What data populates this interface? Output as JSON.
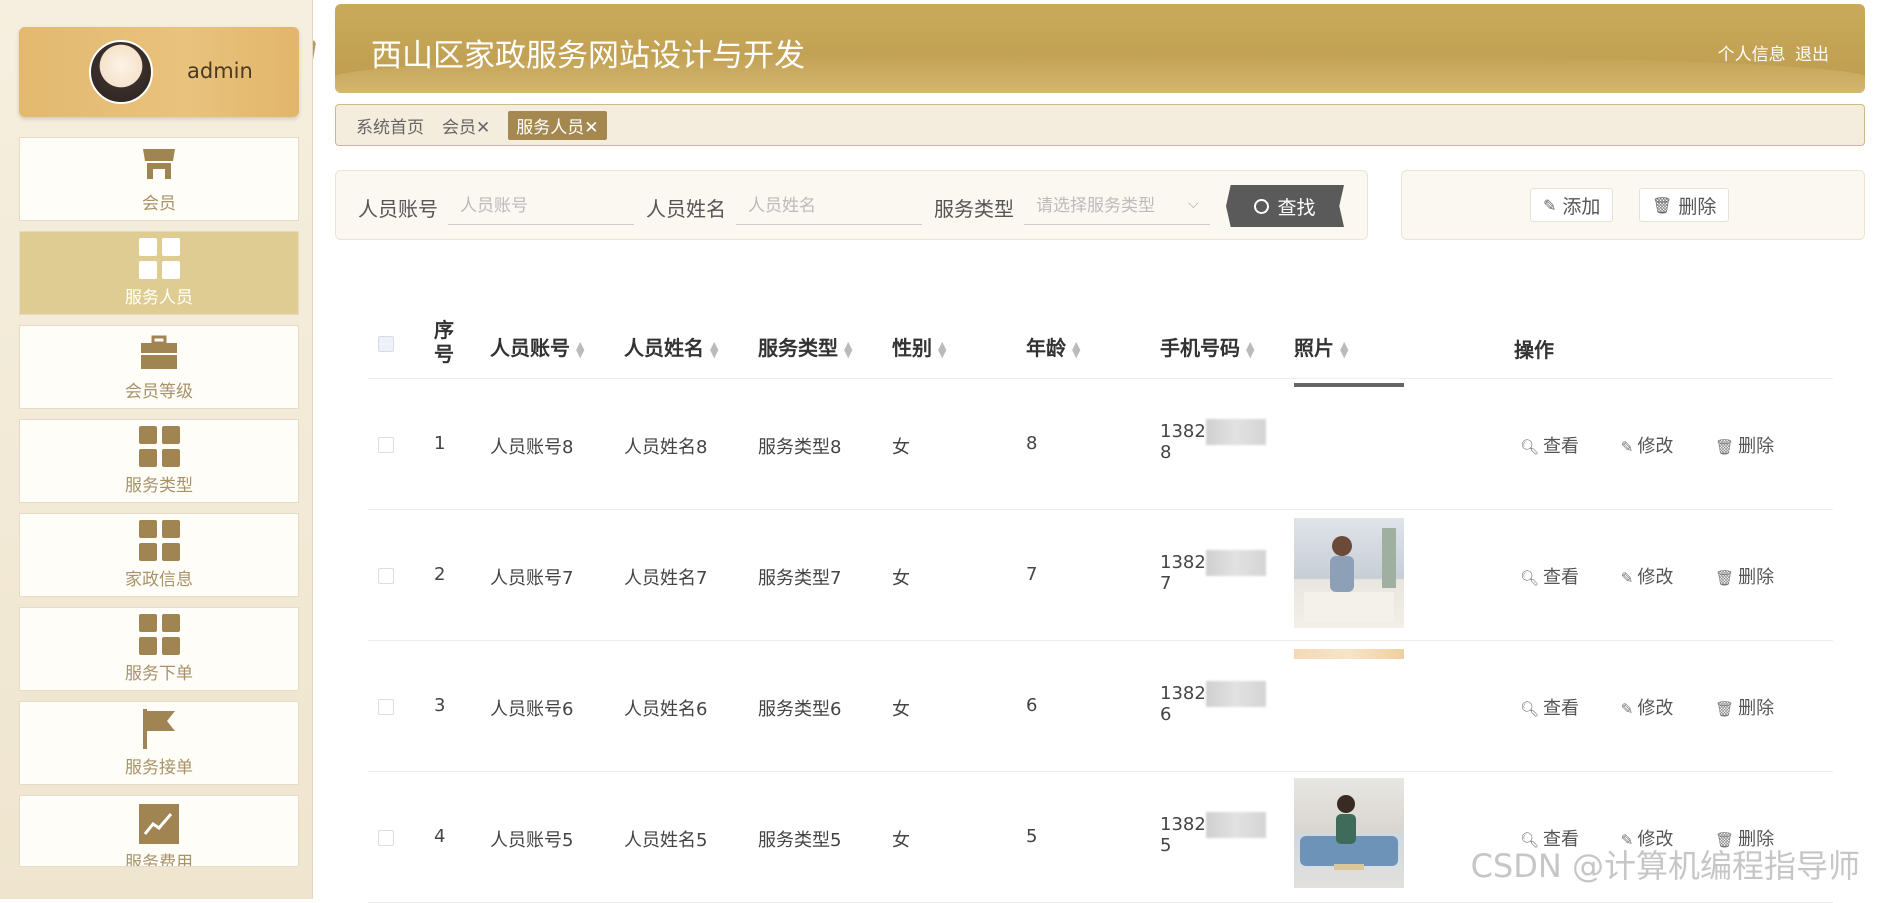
{
  "header": {
    "title": "西山区家政服务网站设计与开发",
    "profile_link": "个人信息",
    "logout_link": "退出"
  },
  "user": {
    "name": "admin"
  },
  "sidebar": {
    "items": [
      {
        "label": "会员",
        "icon": "shop-icon"
      },
      {
        "label": "服务人员",
        "icon": "grid-icon",
        "active": true
      },
      {
        "label": "会员等级",
        "icon": "briefcase-icon"
      },
      {
        "label": "服务类型",
        "icon": "grid-icon"
      },
      {
        "label": "家政信息",
        "icon": "grid-icon"
      },
      {
        "label": "服务下单",
        "icon": "grid-icon"
      },
      {
        "label": "服务接单",
        "icon": "flag-icon"
      },
      {
        "label": "服务费用",
        "icon": "chart-icon"
      }
    ]
  },
  "breadcrumb": {
    "home": "系统首页",
    "tab1": "会员✕",
    "tab2": "服务人员✕"
  },
  "search": {
    "account_label": "人员账号",
    "account_placeholder": "人员账号",
    "name_label": "人员姓名",
    "name_placeholder": "人员姓名",
    "type_label": "服务类型",
    "type_placeholder": "请选择服务类型",
    "search_button": "查找"
  },
  "actions": {
    "add": "添加",
    "delete": "删除"
  },
  "table": {
    "columns": [
      "序号",
      "人员账号",
      "人员姓名",
      "服务类型",
      "性别",
      "年龄",
      "手机号码",
      "照片",
      "操作"
    ],
    "rows": [
      {
        "no": "1",
        "account": "人员账号8",
        "name": "人员姓名8",
        "type": "服务类型8",
        "gender": "女",
        "age": "8",
        "phone_a": "1382",
        "phone_b": "8"
      },
      {
        "no": "2",
        "account": "人员账号7",
        "name": "人员姓名7",
        "type": "服务类型7",
        "gender": "女",
        "age": "7",
        "phone_a": "1382",
        "phone_b": "7"
      },
      {
        "no": "3",
        "account": "人员账号6",
        "name": "人员姓名6",
        "type": "服务类型6",
        "gender": "女",
        "age": "6",
        "phone_a": "1382",
        "phone_b": "6"
      },
      {
        "no": "4",
        "account": "人员账号5",
        "name": "人员姓名5",
        "type": "服务类型5",
        "gender": "女",
        "age": "5",
        "phone_a": "1382",
        "phone_b": "5"
      }
    ],
    "ops": {
      "view": "查看",
      "edit": "修改",
      "delete": "删除"
    }
  },
  "watermark": "CSDN @计算机编程指导师"
}
